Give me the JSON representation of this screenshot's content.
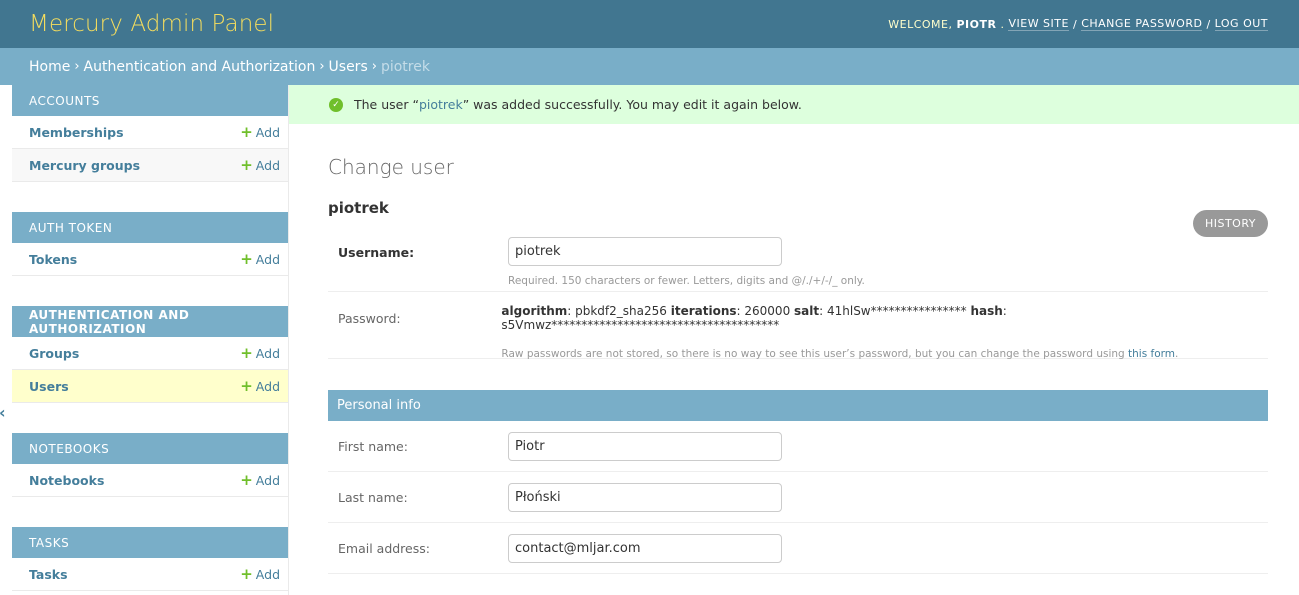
{
  "header": {
    "brand": "Mercury Admin Panel",
    "welcome": "Welcome,",
    "username": "Piotr",
    "links": [
      "View site",
      "Change password",
      "Log out"
    ],
    "sep": "/"
  },
  "breadcrumbs": {
    "items": [
      "Home",
      "Authentication and Authorization",
      "Users"
    ],
    "current": "piotrek",
    "sep": "›"
  },
  "sidebar": {
    "modules": [
      {
        "caption": "Accounts",
        "rows": [
          {
            "model": "Memberships",
            "add": "Add"
          },
          {
            "model": "Mercury groups",
            "add": "Add"
          }
        ]
      },
      {
        "caption": "Auth Token",
        "rows": [
          {
            "model": "Tokens",
            "add": "Add"
          }
        ]
      },
      {
        "caption": "Authentication and Authorization",
        "rows": [
          {
            "model": "Groups",
            "add": "Add"
          },
          {
            "model": "Users",
            "add": "Add"
          }
        ]
      },
      {
        "caption": "Notebooks",
        "rows": [
          {
            "model": "Notebooks",
            "add": "Add"
          }
        ]
      },
      {
        "caption": "Tasks",
        "rows": [
          {
            "model": "Tasks",
            "add": "Add"
          }
        ]
      }
    ],
    "toggle_icon": "«"
  },
  "message": {
    "before": "The user “",
    "link": "piotrek",
    "after": "” was added successfully. You may edit it again below.",
    "icon": "check-circle-icon",
    "check_glyph": "✓"
  },
  "form": {
    "page_title": "Change user",
    "history": "History",
    "object_name": "piotrek",
    "username_label": "Username:",
    "username_value": "piotrek",
    "username_help": "Required. 150 characters or fewer. Letters, digits and @/./+/-/_ only.",
    "password_label": "Password:",
    "pw": {
      "algorithm_label": "algorithm",
      "algorithm_value": ": pbkdf2_sha256",
      "iterations_label": "iterations",
      "iterations_value": ": 260000",
      "salt_label": "salt",
      "salt_value": ": 41hlSw****************",
      "hash_label": "hash",
      "hash_value": ": s5Vmwz**************************************"
    },
    "password_help_before": "Raw passwords are not stored, so there is no way to see this user’s password, but you can change the password using ",
    "password_help_link": "this form",
    "password_help_after": ".",
    "personal_info": "Personal info",
    "first_name_label": "First name:",
    "first_name_value": "Piotr",
    "last_name_label": "Last name:",
    "last_name_value": "Płoński",
    "email_label": "Email address:",
    "email_value": "contact@mljar.com"
  },
  "colors": {
    "header": "#417690",
    "accent": "#79aec8",
    "brand": "#f5dd5d",
    "success": "#dfd",
    "link": "#447e9b"
  }
}
